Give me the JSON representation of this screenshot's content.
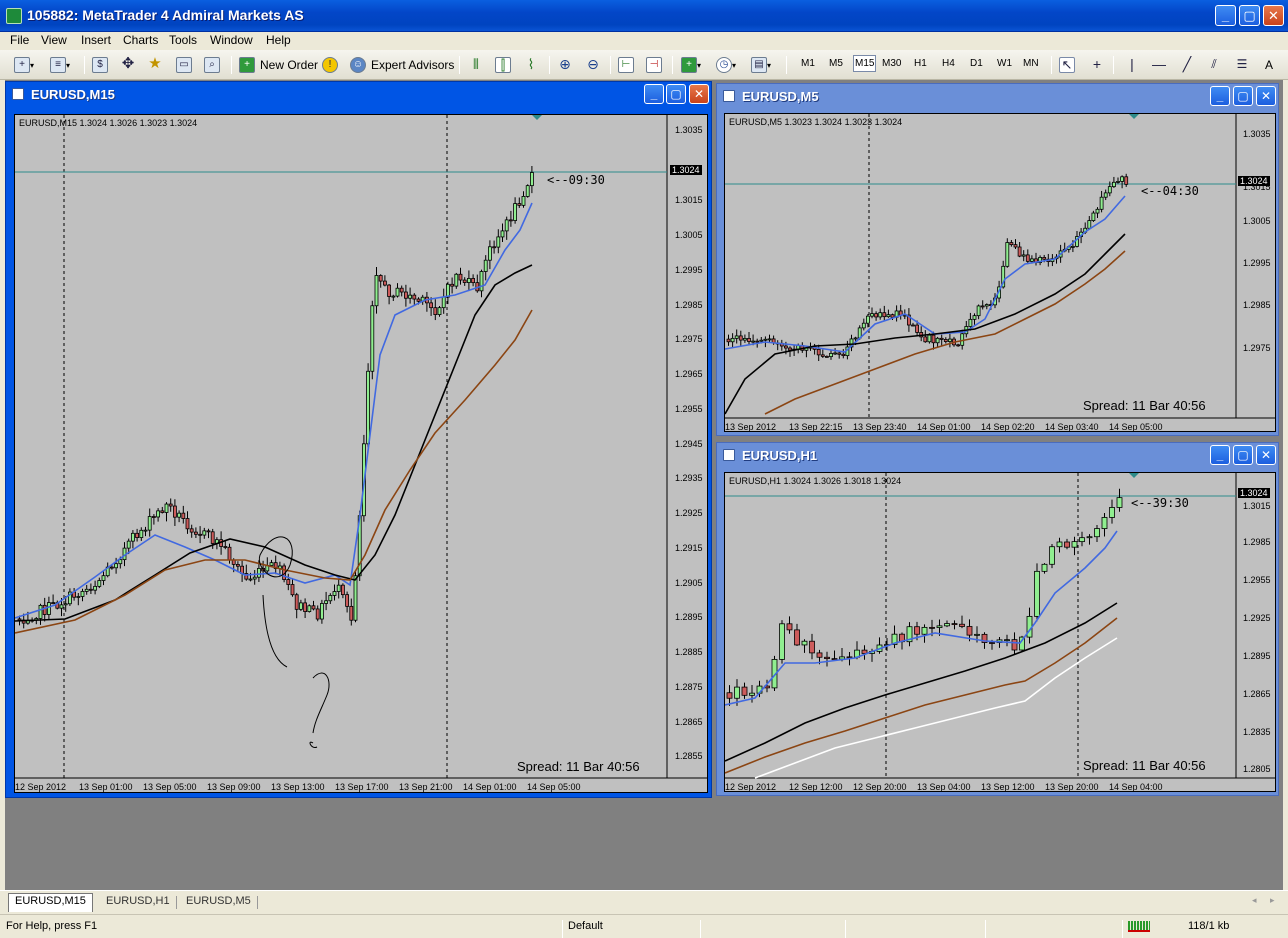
{
  "app": {
    "title": "105882: MetaTrader 4 Admiral Markets AS"
  },
  "menu": [
    "File",
    "View",
    "Insert",
    "Charts",
    "Tools",
    "Window",
    "Help"
  ],
  "toolbar": {
    "new_order": "New Order",
    "expert_advisors": "Expert Advisors",
    "timeframes": [
      "M1",
      "M5",
      "M15",
      "M30",
      "H1",
      "H4",
      "D1",
      "W1",
      "MN"
    ],
    "active_timeframe": "M15",
    "text_tool": "A"
  },
  "windows": {
    "m15": {
      "title": "EURUSD,M15",
      "ohlc": "EURUSD,M15  1.3024 1.3026 1.3023 1.3024",
      "spread": "Spread: 11   Bar  40:56",
      "timer": "<--09:30",
      "current_price": "1.3024",
      "y_labels": [
        "1.3035",
        "1.3015",
        "1.3005",
        "1.2995",
        "1.2985",
        "1.2975",
        "1.2965",
        "1.2955",
        "1.2945",
        "1.2935",
        "1.2925",
        "1.2915",
        "1.2905",
        "1.2895",
        "1.2885",
        "1.2875",
        "1.2865",
        "1.2855"
      ],
      "x_labels": [
        "12 Sep 2012",
        "13 Sep 01:00",
        "13 Sep 05:00",
        "13 Sep 09:00",
        "13 Sep 13:00",
        "13 Sep 17:00",
        "13 Sep 21:00",
        "14 Sep 01:00",
        "14 Sep 05:00"
      ]
    },
    "m5": {
      "title": "EURUSD,M5",
      "ohlc": "EURUSD,M5  1.3023 1.3024 1.3023 1.3024",
      "spread": "Spread: 11   Bar  40:56",
      "timer": "<--04:30",
      "current_price": "1.3024",
      "y_labels": [
        "1.3035",
        "1.3015",
        "1.3005",
        "1.2995",
        "1.2985",
        "1.2975"
      ],
      "x_labels": [
        "13 Sep 2012",
        "13 Sep 22:15",
        "13 Sep 23:40",
        "14 Sep 01:00",
        "14 Sep 02:20",
        "14 Sep 03:40",
        "14 Sep 05:00"
      ]
    },
    "h1": {
      "title": "EURUSD,H1",
      "ohlc": "EURUSD,H1  1.3024 1.3026 1.3018 1.3024",
      "spread": "Spread: 11   Bar  40:56",
      "timer": "<--39:30",
      "current_price": "1.3024",
      "y_labels": [
        "1.3015",
        "1.2985",
        "1.2955",
        "1.2925",
        "1.2895",
        "1.2865",
        "1.2835",
        "1.2805"
      ],
      "x_labels": [
        "12 Sep 2012",
        "12 Sep 12:00",
        "12 Sep 20:00",
        "13 Sep 04:00",
        "13 Sep 12:00",
        "13 Sep 20:00",
        "14 Sep 04:00"
      ]
    }
  },
  "tabs": [
    "EURUSD,M15",
    "EURUSD,H1",
    "EURUSD,M5"
  ],
  "active_tab": "EURUSD,M15",
  "status": {
    "help": "For Help, press F1",
    "profile": "Default",
    "traffic": "118/1 kb"
  },
  "colors": {
    "chart_bg": "#c0c0c0",
    "bull": "#90ee90",
    "bear": "#cd5c5c",
    "ma_fast": "#4169e1",
    "ma_slow": "#000000",
    "ma_mid": "#8b4513",
    "ma_extra": "#ffffff",
    "bid_line": "#2e8b8b",
    "active_window": "#0055e5"
  }
}
